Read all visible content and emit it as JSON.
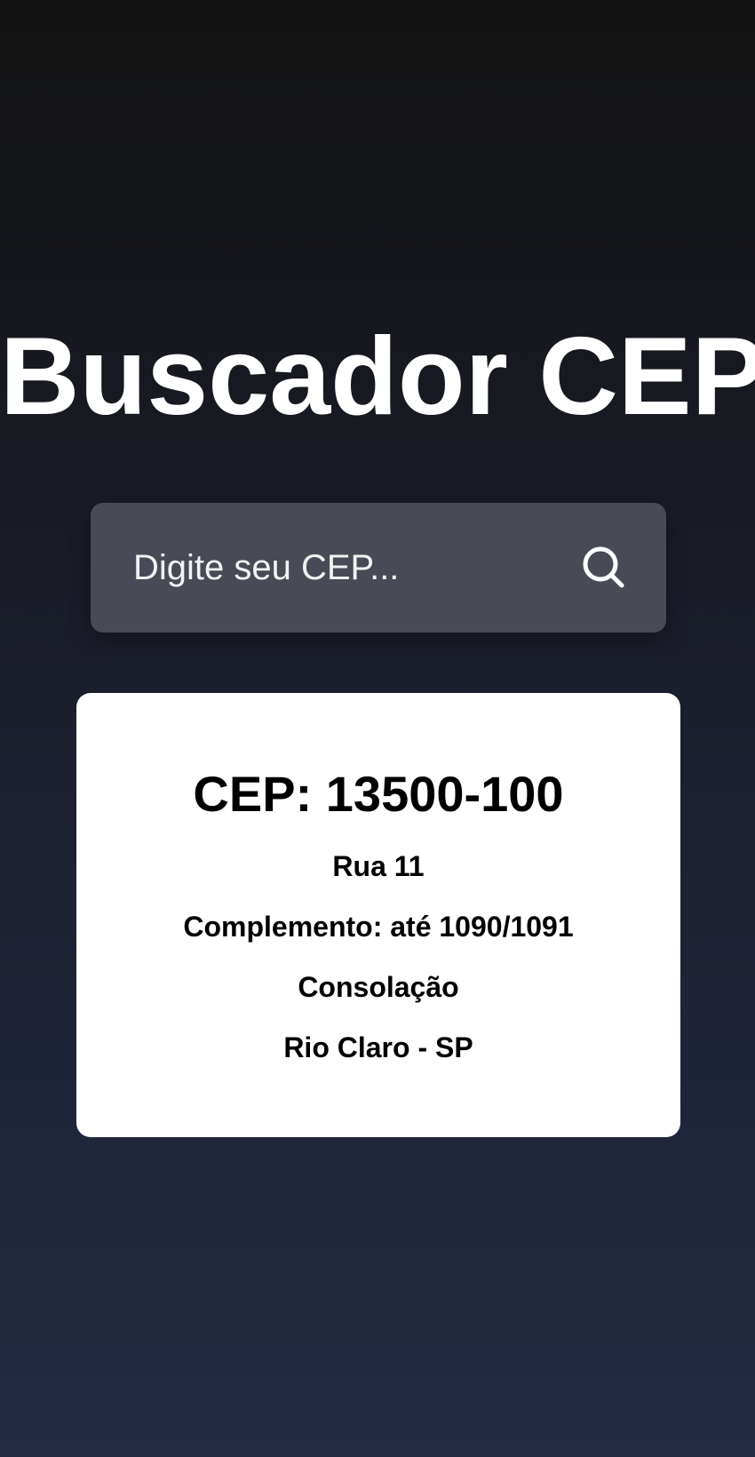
{
  "header": {
    "title": "Buscador CEP"
  },
  "search": {
    "placeholder": "Digite seu CEP...",
    "value": "",
    "icon": "search-icon"
  },
  "result": {
    "cep_line": "CEP: 13500-100",
    "street": "Rua 11",
    "complement": "Complemento: até 1090/1091",
    "district": "Consolação",
    "city_state": "Rio Claro - SP"
  },
  "colors": {
    "background_top": "#121212",
    "background_bottom": "#222a44",
    "search_box": "#484b55",
    "card": "#ffffff",
    "title_text": "#ffffff"
  }
}
